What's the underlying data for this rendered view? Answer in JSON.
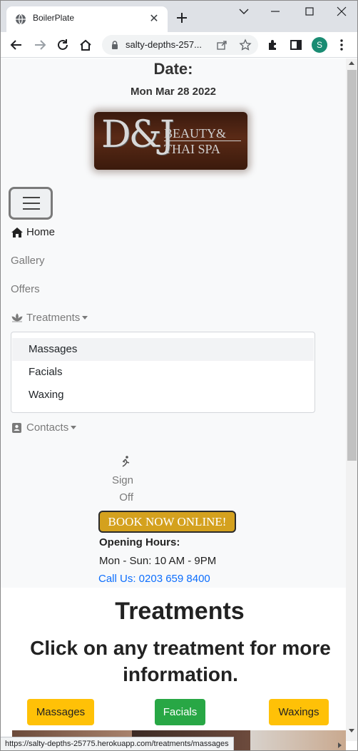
{
  "browser": {
    "tab_title": "BoilerPlate",
    "url": "salty-depths-257...",
    "profile_initial": "S",
    "status_url": "https://salty-depths-25775.herokuapp.com/treatments/massages"
  },
  "page": {
    "date_label": "Date:",
    "date_value": "Mon Mar 28 2022",
    "logo": {
      "monogram": "D&J",
      "line1": "BEAUTY&",
      "line2": "THAI SPA"
    },
    "nav": {
      "home": "Home",
      "gallery": "Gallery",
      "offers": "Offers",
      "treatments": "Treatments",
      "contacts": "Contacts",
      "dropdown": [
        "Massages",
        "Facials",
        "Waxing"
      ]
    },
    "sign_off": "Sign Off",
    "book_now": "BOOK NOW ONLINE!",
    "hours_title": "Opening Hours:",
    "hours_text": "Mon - Sun: 10 AM - 9PM",
    "call": "Call Us: 0203 659 8400",
    "treatments_heading": "Treatments",
    "treatments_sub": "Click on any treatment for more information.",
    "treatment_buttons": [
      "Massages",
      "Facials",
      "Waxings"
    ]
  },
  "colors": {
    "book_button": "#d4a11e",
    "massages_button": "#ffc107",
    "facials_button": "#28a745",
    "link": "#0d6efd",
    "avatar": "#1a8c73"
  }
}
